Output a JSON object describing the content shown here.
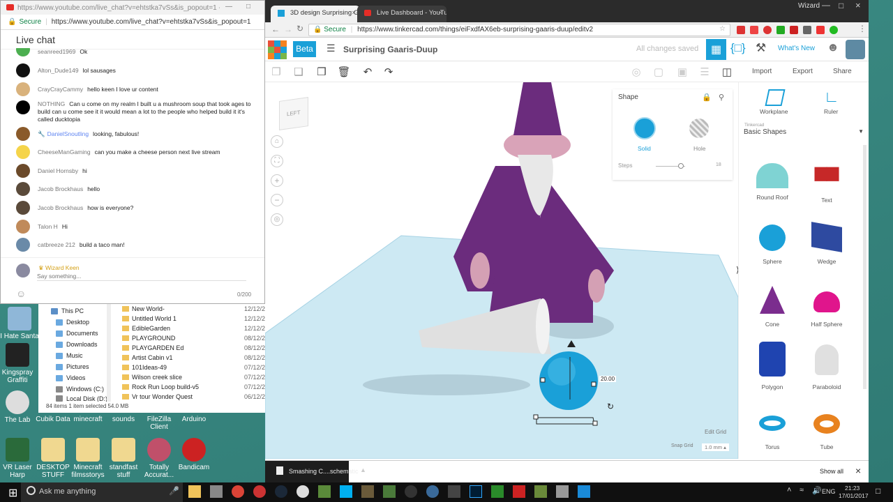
{
  "colors": {
    "desktop": "#3b8a82",
    "tinkercad_blue": "#1aa0d8",
    "accent_orange": "#f58220",
    "purple": "#6b2c7d"
  },
  "chat_window": {
    "title_url": "https://www.youtube.com/live_chat?v=ehtstka7vSs&is_popout=1 - Google Chr...",
    "secure_label": "Secure",
    "url": "https://www.youtube.com/live_chat?v=ehtstka7vSs&is_popout=1",
    "header": "Live chat",
    "messages": [
      {
        "author": "seanreed1969",
        "text": "Ok"
      },
      {
        "author": "Alton_Dude149",
        "text": "lol sausages"
      },
      {
        "author": "CrayCrayCammy",
        "text": "hello keen I love ur content"
      },
      {
        "author": "NOTHING",
        "text": "Can u come on my realm I built u a mushroom soup that took ages to build can u come see it it would mean a lot to the people who helped build it it's called ducktopia"
      },
      {
        "author": "DanielSnoutling",
        "text": "looking, fabulous!"
      },
      {
        "author": "CheeseManGaming",
        "text": "can you make a cheese person next live stream"
      },
      {
        "author": "Daniel Hornsby",
        "text": "hi"
      },
      {
        "author": "Jacob Brockhaus",
        "text": "hello"
      },
      {
        "author": "Jacob Brockhaus",
        "text": "how is everyone?"
      },
      {
        "author": "Talon H",
        "text": "Hi"
      },
      {
        "author": "catbreeze 212",
        "text": "build a taco man!"
      }
    ],
    "input_user": "Wizard Keen",
    "input_placeholder": "Say something...",
    "char_count": "0/200"
  },
  "explorer": {
    "tree": [
      "This PC",
      "Desktop",
      "Documents",
      "Downloads",
      "Music",
      "Pictures",
      "Videos",
      "Windows (C:)",
      "Local Disk (D:)"
    ],
    "files": [
      {
        "name": "New World-",
        "date": "12/12/2"
      },
      {
        "name": "Untitled World 1",
        "date": "12/12/2"
      },
      {
        "name": "EdibleGarden",
        "date": "12/12/2"
      },
      {
        "name": "PLAYGROUND",
        "date": "08/12/2"
      },
      {
        "name": "PLAYGARDEN Ed",
        "date": "08/12/2"
      },
      {
        "name": "Artist Cabin v1",
        "date": "08/12/2"
      },
      {
        "name": "101Ideas-49",
        "date": "07/12/2"
      },
      {
        "name": "Wilson creek slice",
        "date": "07/12/2"
      },
      {
        "name": "Rock Run Loop build-v5",
        "date": "07/12/2"
      },
      {
        "name": "Vr tour Wonder Quest",
        "date": "06/12/2"
      }
    ],
    "status": "84 items    1 item selected  54.0 MB"
  },
  "desktop_icons": [
    {
      "label": "I Hate Santa"
    },
    {
      "label": "Kingspray Graffiti"
    },
    {
      "label": "The Lab"
    },
    {
      "label": "Cubik Data"
    },
    {
      "label": "minecraft"
    },
    {
      "label": "sounds"
    },
    {
      "label": "FileZilla Client"
    },
    {
      "label": "Arduino"
    },
    {
      "label": "VR Laser Harp"
    },
    {
      "label": "DESKTOP STUFF"
    },
    {
      "label": "Minecraft filmsstorys"
    },
    {
      "label": "standfast stuff"
    },
    {
      "label": "Totally Accurat..."
    },
    {
      "label": "Bandicam"
    }
  ],
  "browser": {
    "tabs": [
      {
        "label": "3D design Surprising Ga..."
      },
      {
        "label": "Live Dashboard - YouTu..."
      }
    ],
    "profile": "Wizard",
    "secure_label": "Secure",
    "url": "https://www.tinkercad.com/things/eiFxdfAX6eb-surprising-gaaris-duup/editv2"
  },
  "tinkercad": {
    "logo_letters": [
      "TIN",
      "KER",
      "CAD"
    ],
    "beta_label": "Beta",
    "design_name": "Surprising Gaaris-Duup",
    "save_status": "All changes saved",
    "whats_new": "What's New",
    "actions": {
      "import": "Import",
      "export": "Export",
      "share": "Share"
    },
    "viewcube_label": "LEFT",
    "shape_panel": {
      "title": "Shape",
      "solid": "Solid",
      "hole": "Hole",
      "steps_label": "Steps",
      "steps_value": "18",
      "steps_fraction": 0.85
    },
    "dimension": "20.00",
    "edit_grid": "Edit Grid",
    "snap_grid": "Snap Grid",
    "snap_value": "1.0 mm",
    "workplane": "Workplane",
    "ruler": "Ruler",
    "library_source": "Tinkercad",
    "library_name": "Basic Shapes",
    "shapes": [
      {
        "label": "Round Roof"
      },
      {
        "label": "Text"
      },
      {
        "label": "Sphere"
      },
      {
        "label": "Wedge"
      },
      {
        "label": "Cone"
      },
      {
        "label": "Half Sphere"
      },
      {
        "label": "Polygon"
      },
      {
        "label": "Paraboloid"
      },
      {
        "label": "Torus"
      },
      {
        "label": "Tube"
      }
    ]
  },
  "downloads_bar": {
    "file": "Smashing C....schematic",
    "show_all": "Show all"
  },
  "taskbar": {
    "search_placeholder": "Ask me anything",
    "lang": "ENG",
    "time": "21:23",
    "date": "17/01/2017"
  }
}
